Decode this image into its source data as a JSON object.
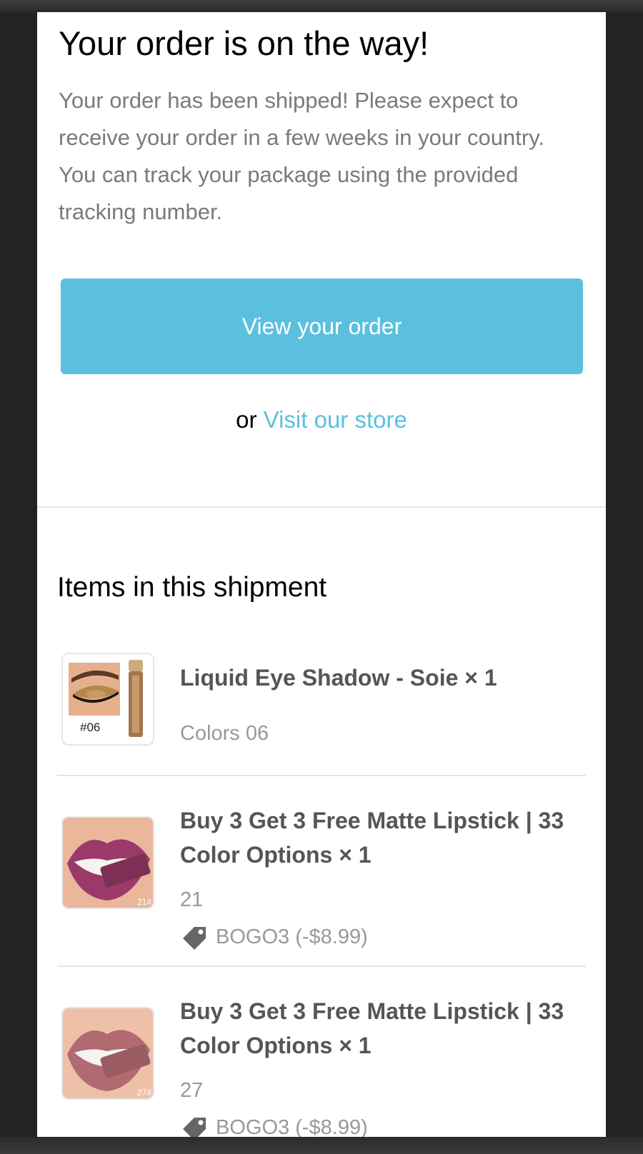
{
  "header": {
    "title": "Your order is on the way!",
    "message": "Your order has been shipped! Please expect to receive your order in a few weeks in your country. You can track your package using the provided tracking number."
  },
  "actions": {
    "view_order_label": "View your order",
    "or_text": "or",
    "visit_store_label": "Visit our store"
  },
  "shipment": {
    "title": "Items in this shipment",
    "items": [
      {
        "title": "Liquid Eye Shadow - Soie × 1",
        "variant": "Colors 06",
        "thumb_label": "#06",
        "thumb_icon": "eyeshadow-product-image"
      },
      {
        "title": "Buy 3 Get 3 Free Matte Lipstick | 33 Color Options × 1",
        "variant": "21",
        "thumb_label": "21#",
        "thumb_icon": "lipstick-product-image",
        "discount": "BOGO3 (-$8.99)"
      },
      {
        "title": "Buy 3 Get 3 Free Matte Lipstick | 33 Color Options × 1",
        "variant": "27",
        "thumb_label": "27#",
        "thumb_icon": "lipstick-product-image",
        "discount": "BOGO3 (-$8.99)"
      }
    ]
  },
  "colors": {
    "accent": "#5bc0de",
    "lip_21": "#9b3a6a",
    "lip_27": "#b06a70"
  }
}
